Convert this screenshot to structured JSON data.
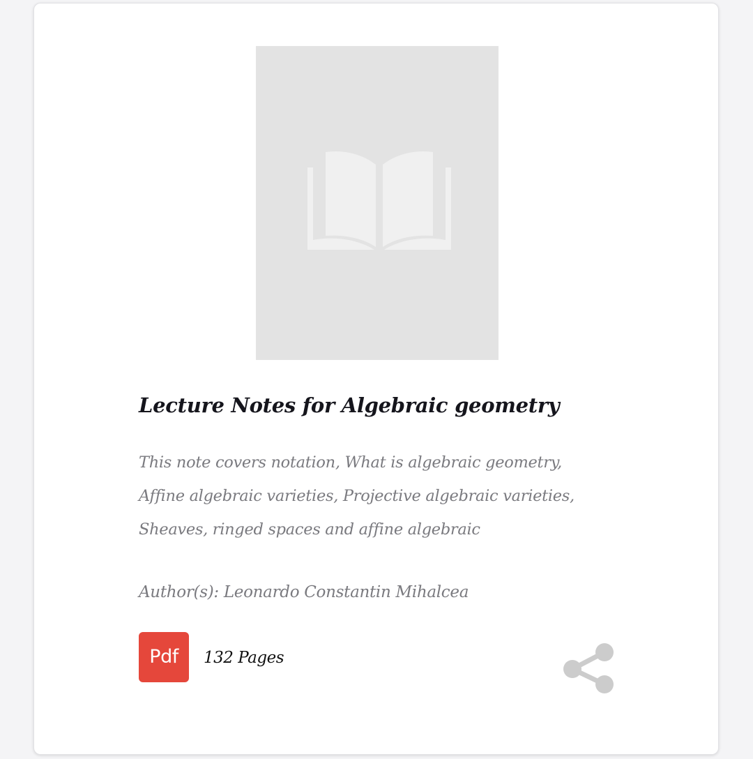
{
  "book": {
    "title": "Lecture Notes for Algebraic geometry",
    "description": "This note covers notation, What is algebraic geometry, Affine algebraic varieties, Projective algebraic varieties, Sheaves, ringed spaces and affine algebraic",
    "author": "Author(s): Leonardo Constantin Mihalcea",
    "file_type": "Pdf",
    "pages": "132 Pages"
  },
  "icons": {
    "cover_placeholder": "open-book-icon",
    "share": "share-icon",
    "pdf": "pdf-icon"
  },
  "colors": {
    "pdf_badge": "#e5473b",
    "cover_background": "#e3e3e3",
    "title": "#15151c",
    "secondary_text": "#7a7a7f",
    "share_icon": "#cccccc"
  }
}
